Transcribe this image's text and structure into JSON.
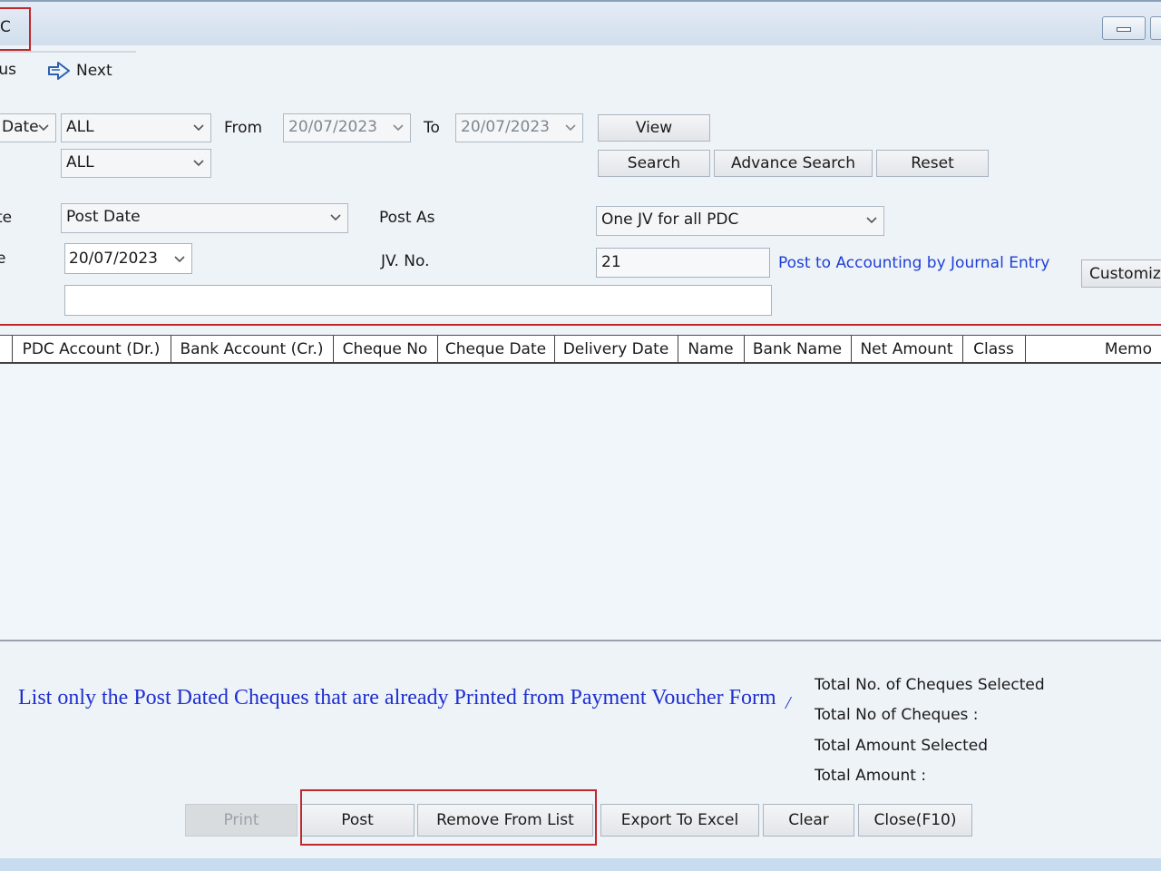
{
  "window": {
    "title_fragment": "C",
    "minimize_icon": "minimize-icon"
  },
  "nav": {
    "previous_label": "ous",
    "next_label": "Next"
  },
  "filters": {
    "date_type_value": "Date",
    "filter1_value": "ALL",
    "filter2_value": "ALL",
    "from_label": "From",
    "from_value": "20/07/2023",
    "to_label": "To",
    "to_value": "20/07/2023"
  },
  "search_buttons": {
    "view": "View",
    "search": "Search",
    "advance_search": "Advance Search",
    "reset": "Reset"
  },
  "posting": {
    "date_label": "te",
    "date_type_value": "Post Date",
    "post_as_label": "Post As",
    "post_as_value": "One JV for all PDC",
    "date2_label": "e",
    "date_value": "20/07/2023",
    "jv_label": "JV. No.",
    "jv_value": "21",
    "link_label": "Post to Accounting by Journal Entry",
    "customize_label": "Customize",
    "memo_value": ""
  },
  "grid": {
    "columns": [
      "PDC Account (Dr.)",
      "Bank Account (Cr.)",
      "Cheque No",
      "Cheque Date",
      "Delivery Date",
      "Name",
      "Bank Name",
      "Net Amount",
      "Class",
      "Memo"
    ],
    "rows": []
  },
  "footer": {
    "note": "List only the Post Dated Cheques that are already Printed from Payment Voucher Form",
    "note_tail": "/",
    "totals": {
      "selected_count_label": "Total No. of Cheques  Selected",
      "count_label": "Total No of Cheques :",
      "selected_amount_label": "Total Amount Selected",
      "amount_label": "Total Amount :"
    }
  },
  "actions": {
    "print": "Print",
    "post": "Post",
    "remove": "Remove From List",
    "export": "Export To Excel",
    "clear": "Clear",
    "close": "Close(F10)"
  },
  "colors": {
    "highlight": "#c0282c",
    "link": "#1f3fd6",
    "note": "#1f2fd0"
  }
}
